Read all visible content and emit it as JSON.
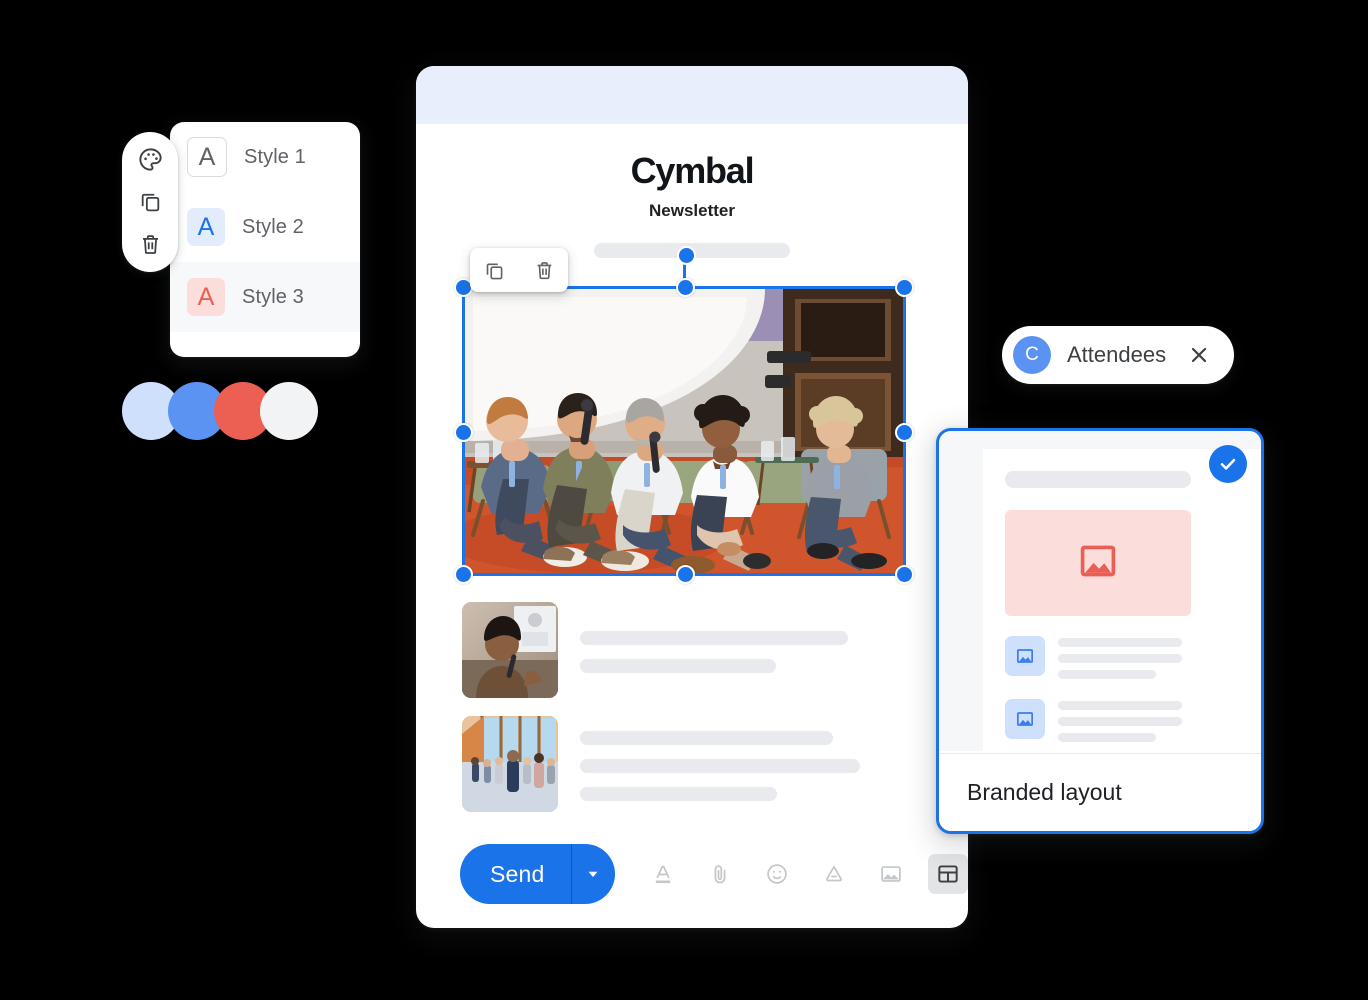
{
  "style_picker": {
    "rail_icons": [
      {
        "name": "palette-icon",
        "label": "Palette"
      },
      {
        "name": "duplicate-icon",
        "label": "Duplicate"
      },
      {
        "name": "trash-icon",
        "label": "Delete"
      }
    ],
    "options": [
      {
        "label": "Style 1",
        "glyph": "A",
        "swatch_bg": "#ffffff",
        "glyph_color": "#5f6368",
        "active": false
      },
      {
        "label": "Style 2",
        "glyph": "A",
        "swatch_bg": "#e3ecfd",
        "glyph_color": "#1a73e8",
        "active": false
      },
      {
        "label": "Style 3",
        "glyph": "A",
        "swatch_bg": "#fbdedb",
        "glyph_color": "#ea5f53",
        "active": true
      }
    ]
  },
  "color_swatches": [
    {
      "name": "color-swatch-light-blue",
      "hex": "#cfe0fd"
    },
    {
      "name": "color-swatch-blue",
      "hex": "#5b93f2"
    },
    {
      "name": "color-swatch-coral",
      "hex": "#ec5f53"
    },
    {
      "name": "color-swatch-white",
      "hex": "#f1f3f4"
    }
  ],
  "compose": {
    "brand_name": "Cymbal",
    "brand_subtitle": "Newsletter",
    "image_toolbar": [
      {
        "name": "copy-icon",
        "label": "Copy"
      },
      {
        "name": "trash-icon",
        "label": "Delete"
      }
    ],
    "send_label": "Send",
    "send_caret_name": "chevron-down-icon",
    "footer_icons": [
      {
        "name": "format-text-icon",
        "label": "Formatting options",
        "active": false
      },
      {
        "name": "attach-file-icon",
        "label": "Attach files",
        "active": false
      },
      {
        "name": "emoji-icon",
        "label": "Insert emoji",
        "active": false
      },
      {
        "name": "drive-icon",
        "label": "Insert from Drive",
        "active": false
      },
      {
        "name": "insert-image-icon",
        "label": "Insert photo",
        "active": false
      },
      {
        "name": "layout-icon",
        "label": "Insert layout",
        "active": true
      }
    ]
  },
  "attendees_chip": {
    "avatar_initial": "C",
    "label": "Attendees",
    "close_name": "close-icon",
    "avatar_color": "#5b93f2"
  },
  "branded_card": {
    "label": "Branded layout",
    "selected": true,
    "check_color": "#1a73e8",
    "hero_name": "image-placeholder-icon",
    "list_items": [
      {
        "thumb_name": "image-placeholder-icon"
      },
      {
        "thumb_name": "image-placeholder-icon"
      }
    ]
  }
}
